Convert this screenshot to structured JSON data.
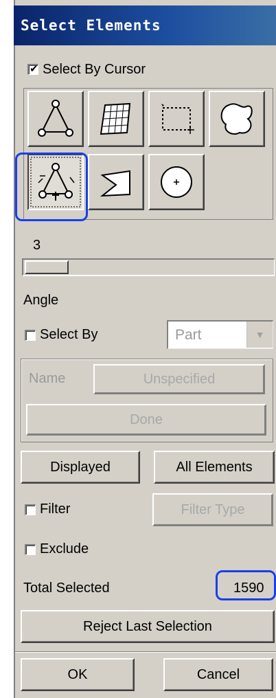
{
  "window": {
    "title": "Select Elements"
  },
  "select_by_cursor": {
    "label": "Select By Cursor",
    "checked": true
  },
  "tools": [
    {
      "name": "node-triangle-icon",
      "pressed": false
    },
    {
      "name": "surface-mesh-icon",
      "pressed": false
    },
    {
      "name": "box-select-icon",
      "pressed": false
    },
    {
      "name": "freehand-loop-icon",
      "pressed": false
    },
    {
      "name": "node-triangle-cursor-icon",
      "pressed": true
    },
    {
      "name": "polygon-icon",
      "pressed": false
    },
    {
      "name": "circle-select-icon",
      "pressed": false
    }
  ],
  "slider": {
    "value": "3"
  },
  "angle": {
    "label": "Angle"
  },
  "select_by": {
    "label": "Select By",
    "checked": false,
    "dropdown_value": "Part"
  },
  "name_row": {
    "label": "Name",
    "value_button": "Unspecified",
    "done_button": "Done"
  },
  "buttons": {
    "displayed": "Displayed",
    "all_elements": "All Elements",
    "filter_type": "Filter Type",
    "reject_last": "Reject Last Selection",
    "ok": "OK",
    "cancel": "Cancel"
  },
  "filter": {
    "label": "Filter",
    "checked": false
  },
  "exclude": {
    "label": "Exclude",
    "checked": false
  },
  "total_selected": {
    "label": "Total Selected",
    "value": "1590"
  },
  "colors": {
    "title_bar": "#0a246a",
    "highlight": "#1a3ee8",
    "face": "#d4d0c8"
  }
}
